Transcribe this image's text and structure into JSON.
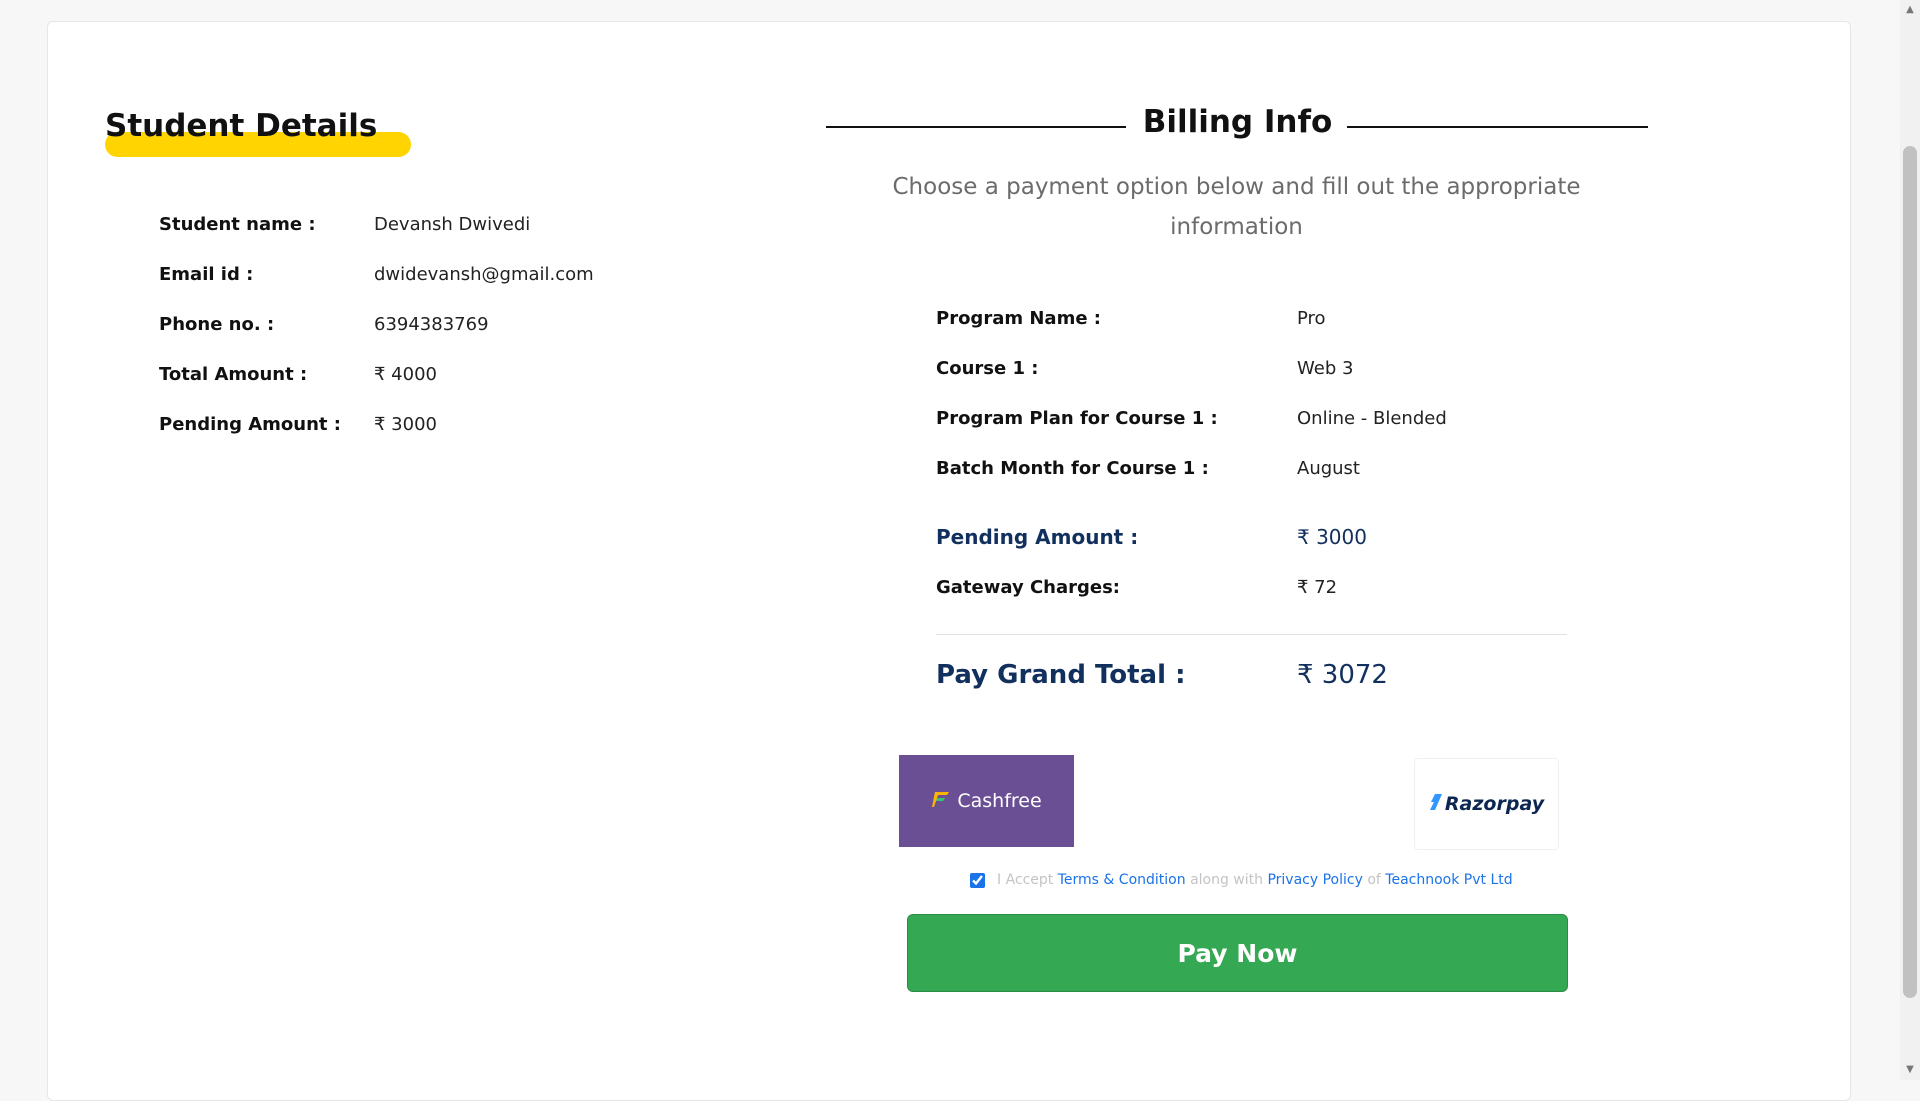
{
  "student_details": {
    "title": "Student Details",
    "rows": [
      {
        "label": "Student name :",
        "value": "Devansh Dwivedi"
      },
      {
        "label": "Email id :",
        "value": "dwidevansh@gmail.com"
      },
      {
        "label": "Phone no. :",
        "value": "6394383769"
      },
      {
        "label": "Total Amount :",
        "value": "₹ 4000"
      },
      {
        "label": "Pending Amount :",
        "value": "₹ 3000"
      }
    ]
  },
  "billing_info": {
    "title": "Billing Info",
    "subtitle": "Choose a payment option below and fill out the appropriate information",
    "rows": [
      {
        "label": "Program Name :",
        "value": "Pro"
      },
      {
        "label": "Course 1 :",
        "value": "Web 3"
      },
      {
        "label": "Program Plan for Course 1 :",
        "value": "Online - Blended"
      },
      {
        "label": "Batch Month for Course 1 :",
        "value": "August"
      },
      {
        "label": "Pending Amount :",
        "value": "₹ 3000"
      },
      {
        "label": "Gateway Charges:",
        "value": "₹ 72"
      }
    ],
    "grand_total": {
      "label": "Pay Grand Total :",
      "value": "₹ 3072"
    }
  },
  "gateways": {
    "cashfree": {
      "label": "Cashfree",
      "icon": "cashfree-logo-icon"
    },
    "razorpay": {
      "label": "Razorpay",
      "icon": "razorpay-logo-icon"
    }
  },
  "terms": {
    "checked": true,
    "prefix": "I Accept",
    "terms_link": "Terms & Condition",
    "middle": "along with",
    "privacy_link": "Privacy Policy",
    "of": "of",
    "company_link": "Teachnook Pvt Ltd"
  },
  "pay_button": {
    "label": "Pay Now"
  },
  "colors": {
    "accent_yellow": "#ffd400",
    "navy": "#11305e",
    "pay_green": "#34a853",
    "cashfree_purple": "#6b4f94",
    "link_blue": "#1a73e8"
  }
}
